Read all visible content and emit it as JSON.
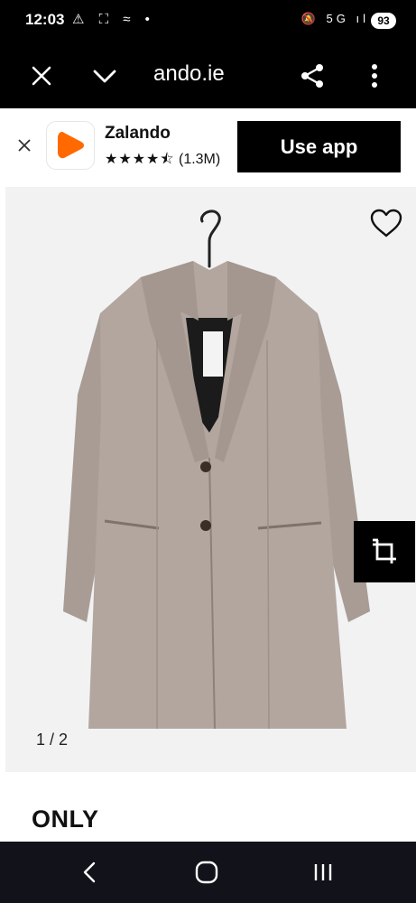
{
  "status_bar": {
    "time": "12:03",
    "left_icons": "⚠ ⛶ ≈ •",
    "right_icons": "🔕 5G ıl",
    "battery": "93"
  },
  "browser": {
    "url": "ando.ie"
  },
  "app_banner": {
    "app_name": "Zalando",
    "stars": "★★★★⯪",
    "rating_count": "(1.3M)",
    "use_app_label": "Use app",
    "accent_color": "#ff6900"
  },
  "product": {
    "image_counter": "1 / 2",
    "label_brand_text": "ONLY",
    "brand": "ONLY"
  },
  "icons": {
    "close": "close-icon",
    "chevron": "chevron-down-icon",
    "share": "share-icon",
    "more": "more-vert-icon",
    "heart": "heart-icon",
    "crop": "view-similar-icon",
    "back": "back-icon",
    "home": "home-icon",
    "recents": "recents-icon"
  }
}
